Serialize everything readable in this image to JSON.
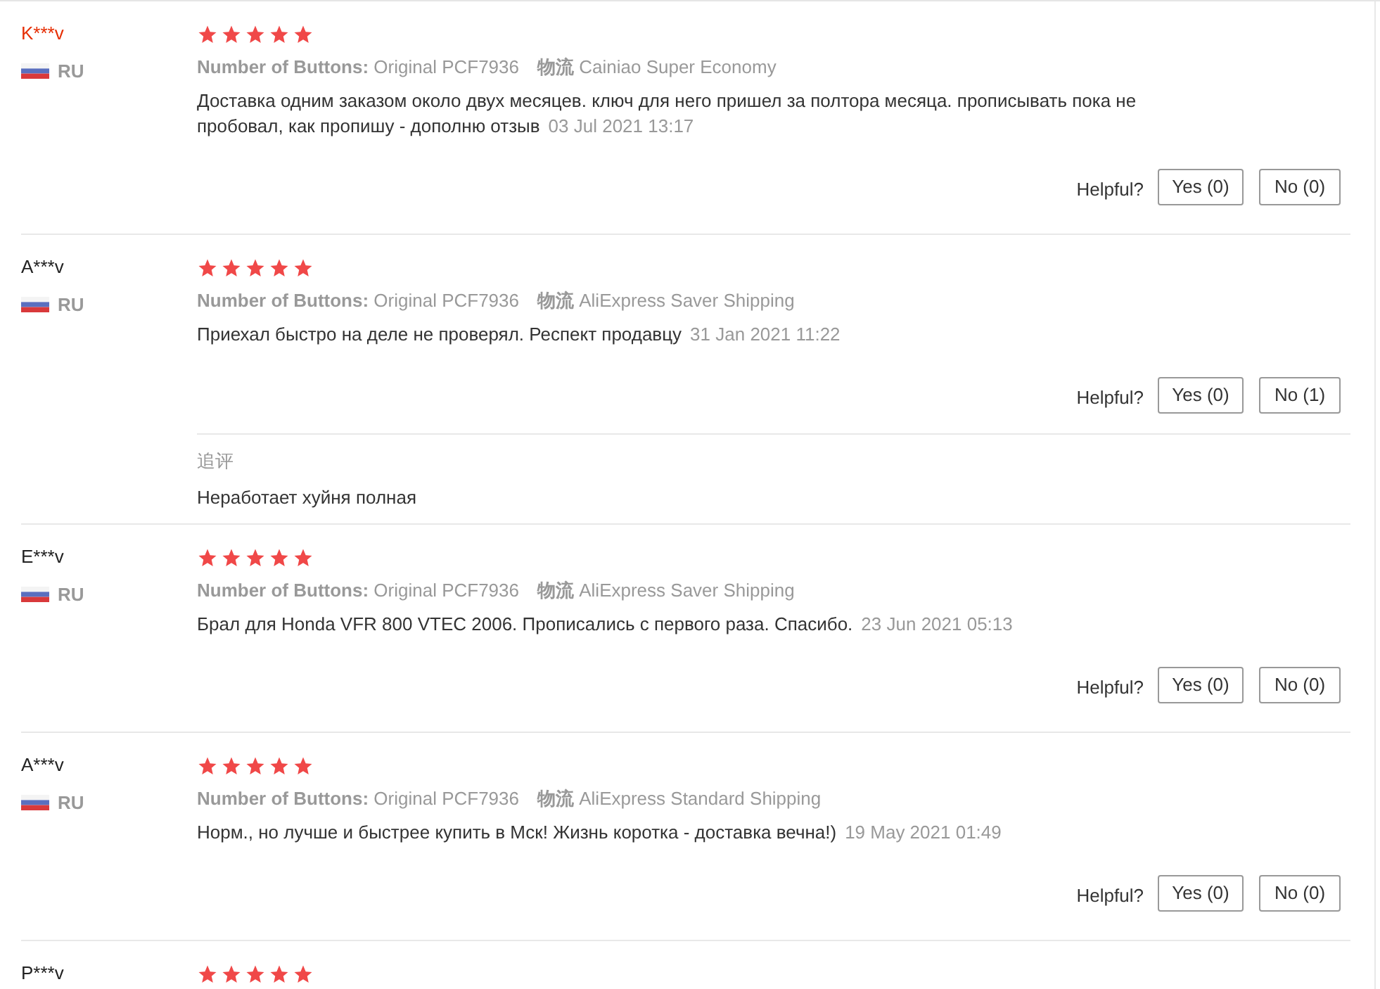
{
  "reviews": [
    {
      "user": "K***v",
      "highlighted": true,
      "country": "RU",
      "stars": 5,
      "attributes": [
        {
          "label": "Number of Buttons:",
          "value": "Original PCF7936"
        },
        {
          "label": "物流",
          "value": "Cainiao Super Economy"
        }
      ],
      "text": "Доставка одним заказом около двух месяцев. ключ для него пришел за полтора месяца. прописывать пока не пробовал, как пропишу - дополню отзыв",
      "date": "03 Jul 2021 13:17",
      "helpful_label": "Helpful?",
      "yes": "Yes (0)",
      "no": "No (0)"
    },
    {
      "user": "A***v",
      "highlighted": false,
      "country": "RU",
      "stars": 5,
      "attributes": [
        {
          "label": "Number of Buttons:",
          "value": "Original PCF7936"
        },
        {
          "label": "物流",
          "value": "AliExpress Saver Shipping"
        }
      ],
      "text": "Приехал быстро на деле не проверял. Респект продавцу",
      "date": "31 Jan 2021 11:22",
      "helpful_label": "Helpful?",
      "yes": "Yes (0)",
      "no": "No (1)",
      "follow_up": {
        "label": "追评",
        "text": "Неработает хуйня полная"
      }
    },
    {
      "user": "E***v",
      "highlighted": false,
      "country": "RU",
      "stars": 5,
      "attributes": [
        {
          "label": "Number of Buttons:",
          "value": "Original PCF7936"
        },
        {
          "label": "物流",
          "value": "AliExpress Saver Shipping"
        }
      ],
      "text": "Брал для Honda VFR 800 VTEC 2006. Прописались с первого раза. Спасибо.",
      "date": "23 Jun 2021 05:13",
      "helpful_label": "Helpful?",
      "yes": "Yes (0)",
      "no": "No (0)"
    },
    {
      "user": "A***v",
      "highlighted": false,
      "country": "RU",
      "stars": 5,
      "attributes": [
        {
          "label": "Number of Buttons:",
          "value": "Original PCF7936"
        },
        {
          "label": "物流",
          "value": "AliExpress Standard Shipping"
        }
      ],
      "text": "Норм., но лучше и быстрее купить в Мск! Жизнь коротка - доставка вечна!)",
      "date": "19 May 2021 01:49",
      "helpful_label": "Helpful?",
      "yes": "Yes (0)",
      "no": "No (0)"
    },
    {
      "user": "P***v",
      "highlighted": false,
      "stars": 5
    }
  ]
}
